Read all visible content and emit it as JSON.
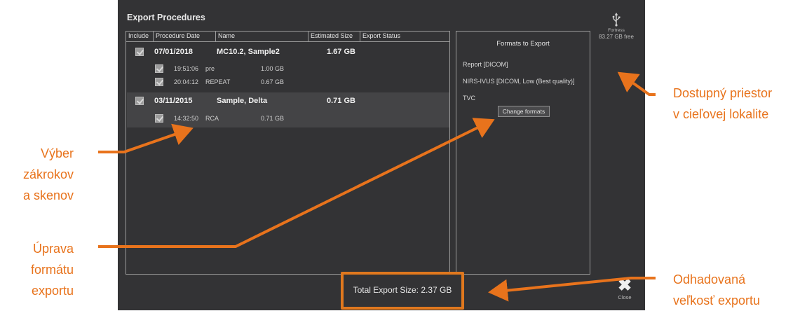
{
  "dialog": {
    "title": "Export Procedures",
    "columns": [
      "Include",
      "Procedure Date",
      "Name",
      "Estimated Size",
      "Export Status"
    ],
    "procedures": [
      {
        "date": "07/01/2018",
        "name": "MC10.2, Sample2",
        "size": "1.67 GB",
        "scans": [
          {
            "time": "19:51:06",
            "name": "pre",
            "size": "1.00 GB"
          },
          {
            "time": "20:04:12",
            "name": "REPEAT",
            "size": "0.67 GB"
          }
        ]
      },
      {
        "date": "03/11/2015",
        "name": "Sample, Delta",
        "size": "0.71 GB",
        "scans": [
          {
            "time": "14:32:50",
            "name": "RCA",
            "size": "0.71 GB"
          }
        ]
      }
    ],
    "formats": {
      "title": "Formats to Export",
      "items": [
        "Report [DICOM]",
        "NIRS-IVUS [DICOM, Low (Best quality)]",
        "TVC"
      ],
      "change_button": "Change formats"
    },
    "device": {
      "icon": "usb-icon",
      "name": "Fortress",
      "free": "83.27 GB free"
    },
    "total_export_size": "Total Export Size: 2.37 GB",
    "close_label": "Close",
    "close_icon": "close-x-icon"
  },
  "annotations": {
    "selection": [
      "Výber",
      "zákrokov",
      "a skenov"
    ],
    "format_edit": [
      "Úprava",
      "formátu",
      "exportu"
    ],
    "space": [
      "Dostupný priestor",
      "v cieľovej lokalite"
    ],
    "estimated": [
      "Odhadovaná",
      "veľkosť exportu"
    ],
    "color": "#e8731c"
  },
  "colors": {
    "dialog_bg": "#333335",
    "highlight_bg": "#444446",
    "accent": "#e0781e"
  }
}
